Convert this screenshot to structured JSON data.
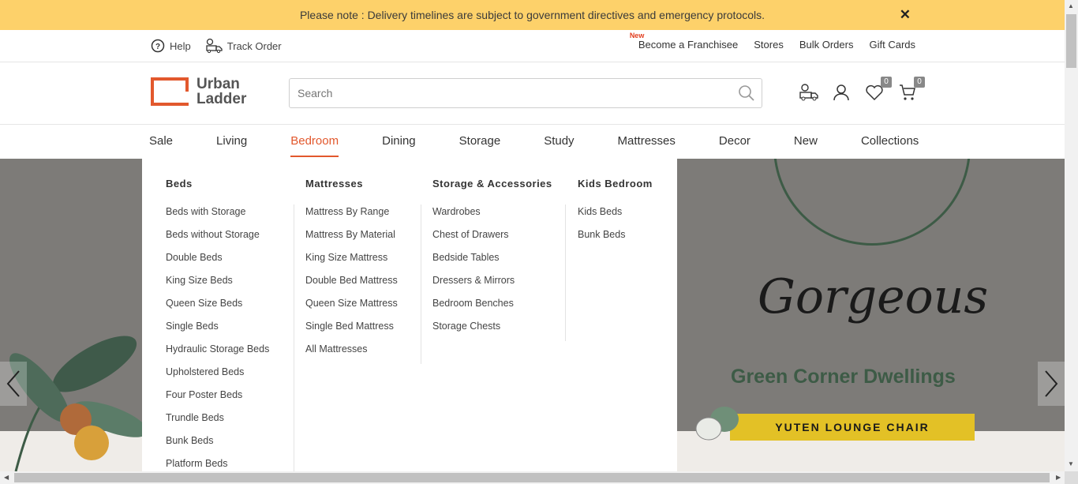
{
  "notice": {
    "text": "Please note : Delivery timelines are subject to government directives and emergency protocols.",
    "close": "✕"
  },
  "utility": {
    "help": "Help",
    "track_order": "Track Order",
    "new_badge": "New",
    "links": [
      "Become a Franchisee",
      "Stores",
      "Bulk Orders",
      "Gift Cards"
    ]
  },
  "header": {
    "logo_line1": "Urban",
    "logo_line2": "Ladder",
    "search_placeholder": "Search",
    "wishlist_count": "0",
    "cart_count": "0"
  },
  "nav": {
    "items": [
      "Sale",
      "Living",
      "Bedroom",
      "Dining",
      "Storage",
      "Study",
      "Mattresses",
      "Decor",
      "New",
      "Collections"
    ],
    "active": "Bedroom"
  },
  "mega_menu": {
    "columns": [
      {
        "title": "Beds",
        "items": [
          "Beds with Storage",
          "Beds without Storage",
          "Double Beds",
          "King Size Beds",
          "Queen Size Beds",
          "Single Beds",
          "Hydraulic Storage Beds",
          "Upholstered Beds",
          "Four Poster Beds",
          "Trundle Beds",
          "Bunk Beds",
          "Platform Beds"
        ]
      },
      {
        "title": "Mattresses",
        "items": [
          "Mattress By Range",
          "Mattress By Material",
          "King Size Mattress",
          "Double Bed Mattress",
          "Queen Size Mattress",
          "Single Bed Mattress",
          "All Mattresses"
        ]
      },
      {
        "title": "Storage & Accessories",
        "items": [
          "Wardrobes",
          "Chest of Drawers",
          "Bedside Tables",
          "Dressers & Mirrors",
          "Bedroom Benches",
          "Storage Chests"
        ]
      },
      {
        "title": "Kids Bedroom",
        "items": [
          "Kids Beds",
          "Bunk Beds"
        ]
      }
    ]
  },
  "hero": {
    "headline": "Gorgeous",
    "subheadline": "Green Corner Dwellings",
    "tag": "YUTEN LOUNGE CHAIR"
  },
  "colors": {
    "accent": "#e2582d",
    "notice_bg": "#fdd16a"
  }
}
